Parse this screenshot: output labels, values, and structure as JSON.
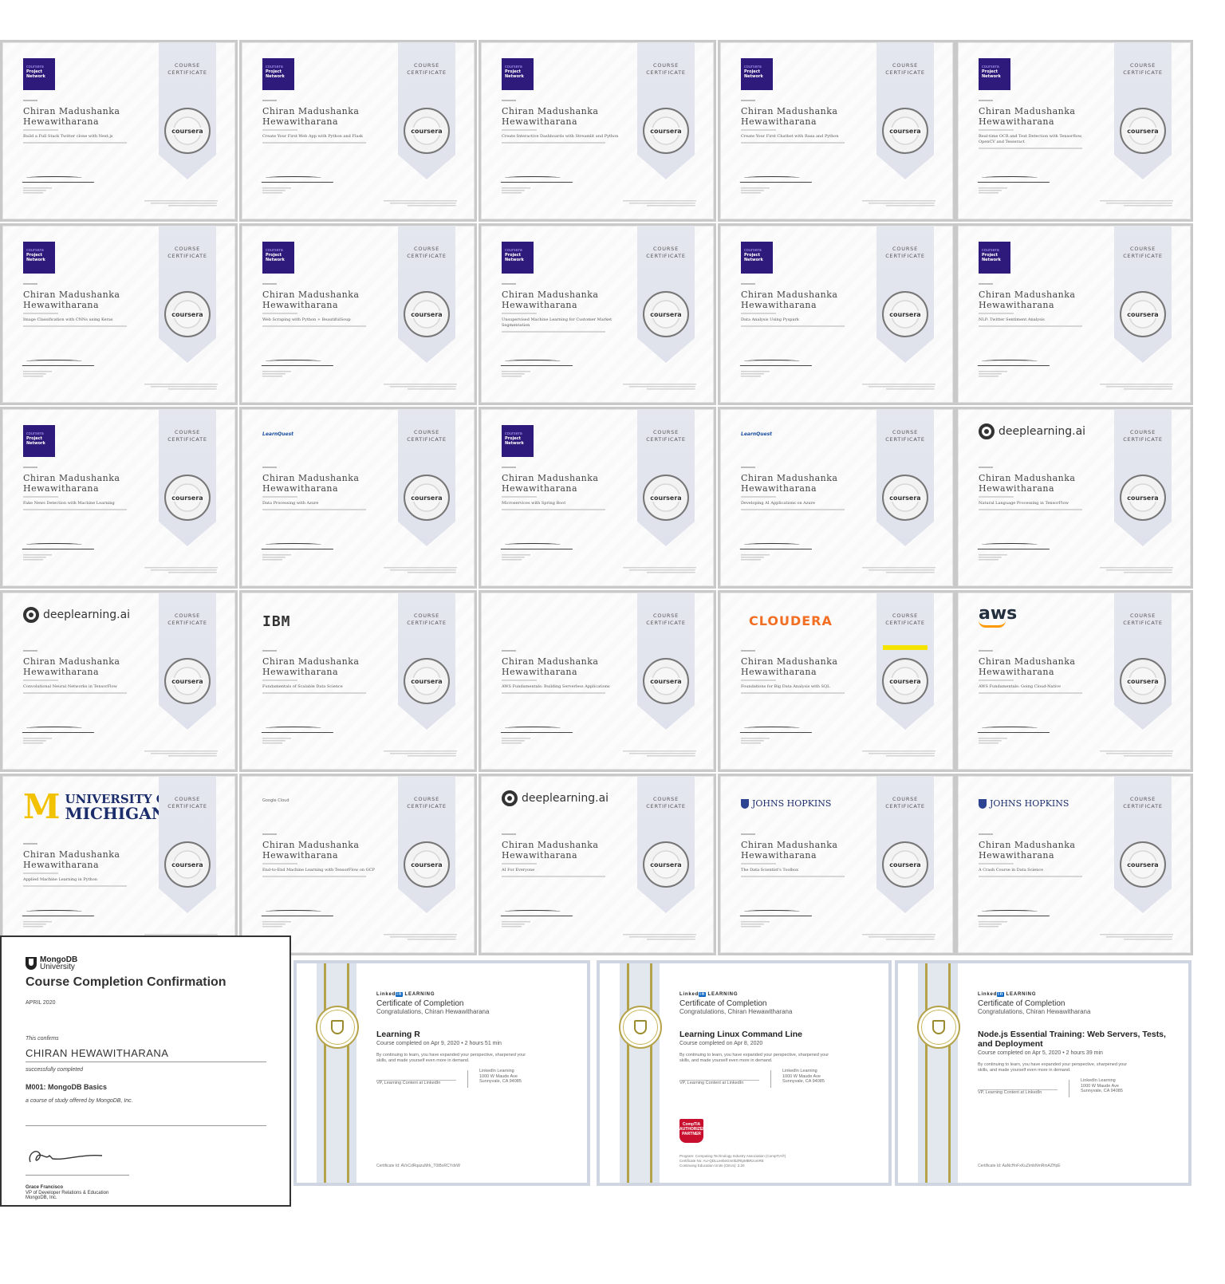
{
  "ribbon_text": "COURSE\nCERTIFICATE",
  "seal_text": "coursera",
  "learner_name": "Chiran Madushanka\nHewawitharana",
  "certificates": [
    {
      "logo": "coursera-project-network",
      "course": "Build a Full Stack Twitter clone with Next.js"
    },
    {
      "logo": "coursera-project-network",
      "course": "Create Your First Web App with Python and Flask"
    },
    {
      "logo": "coursera-project-network",
      "course": "Create Interactive Dashboards with Streamlit and Python"
    },
    {
      "logo": "coursera-project-network",
      "course": "Create Your First Chatbot with Rasa and Python"
    },
    {
      "logo": "coursera-project-network",
      "course": "Real-time OCR and Text Detection with Tensorflow, OpenCV and Tesseract"
    },
    {
      "logo": "coursera-project-network",
      "course": "Image Classification with CNNs using Keras"
    },
    {
      "logo": "coursera-project-network",
      "course": "Web Scraping with Python + BeautifulSoup"
    },
    {
      "logo": "coursera-project-network",
      "course": "Unsupervised Machine Learning for Customer Market Segmentation"
    },
    {
      "logo": "coursera-project-network",
      "course": "Data Analysis Using Pyspark"
    },
    {
      "logo": "coursera-project-network",
      "course": "NLP: Twitter Sentiment Analysis"
    },
    {
      "logo": "coursera-project-network",
      "course": "Fake News Detection with Machine Learning"
    },
    {
      "logo": "learnquest",
      "course": "Data Processing with Azure"
    },
    {
      "logo": "coursera-project-network",
      "course": "Microservices with Spring Boot"
    },
    {
      "logo": "learnquest",
      "course": "Developing AI Applications on Azure"
    },
    {
      "logo": "deeplearning",
      "course": "Natural Language Processing in TensorFlow"
    },
    {
      "logo": "deeplearning",
      "course": "Convolutional Neural Networks in TensorFlow"
    },
    {
      "logo": "ibm",
      "course": "Fundamentals of Scalable Data Science"
    },
    {
      "logo": "none",
      "course": "AWS Fundamentals: Building Serverless Applications"
    },
    {
      "logo": "cloudera",
      "course": "Foundations for Big Data Analysis with SQL"
    },
    {
      "logo": "aws",
      "course": "AWS Fundamentals: Going Cloud-Native"
    },
    {
      "logo": "umich",
      "course": "Applied Machine Learning in Python"
    },
    {
      "logo": "google-cloud",
      "course": "End-to-End Machine Learning with TensorFlow on GCP"
    },
    {
      "logo": "deeplearning",
      "course": "AI For Everyone"
    },
    {
      "logo": "jhu",
      "course": "The Data Scientist's Toolbox"
    },
    {
      "logo": "jhu",
      "course": "A Crash Course in Data Science"
    }
  ],
  "logos": {
    "cpn_line1": "coursera",
    "cpn_line2": "Project",
    "cpn_line3": "Network",
    "deeplearning": "deeplearning.ai",
    "ibm": "IBM",
    "cloudera": "CLOUDERA",
    "aws": "aws",
    "learnquest": "LearnQuest",
    "umich_line1": "UNIVERSITY OF",
    "umich_line2": "MICHIGAN",
    "umich_block": "M",
    "google_cloud": "Google Cloud",
    "jhu": "JOHNS HOPKINS"
  },
  "mongodb": {
    "brand_line1": "MongoDB",
    "brand_line2": "University",
    "title": "Course Completion Confirmation",
    "date": "APRIL 2020",
    "confirms": "This confirms",
    "name": "CHIRAN HEWAWITHARANA",
    "completed": "successfully completed",
    "course": "M001: MongoDB Basics",
    "offered": "a course of study offered by MongoDB, Inc.",
    "signer_name": "Grace Francisco",
    "signer_title": "VP of Developer Relations & Education",
    "signer_org": "MongoDB, Inc."
  },
  "linkedin": [
    {
      "brand": "LEARNING",
      "heading": "Certificate of Completion",
      "congrats": "Congratulations, Chiran Hewawitharana",
      "course": "Learning R",
      "completed": "Course completed on Apr 9, 2020  •  2 hours 51 min",
      "body": "By continuing to learn, you have expanded your perspective, sharpened your skills, and made yourself even more in demand.",
      "signer_title": "VP, Learning Content at LinkedIn",
      "address": "LinkedIn Learning\n1000 W Maude Ave\nSunnyvale, CA 94085",
      "cert_no": "Certificate Id: AVxCdRqazuMrk_T0tBxRCYdvW"
    },
    {
      "brand": "LEARNING",
      "heading": "Certificate of Completion",
      "congrats": "Congratulations, Chiran Hewawitharana",
      "course": "Learning Linux Command Line",
      "completed": "Course completed on Apr 8, 2020",
      "body": "By continuing to learn, you have expanded your perspective, sharpened your skills, and made yourself even more in demand.",
      "signer_title": "VP, Learning Content at LinkedIn",
      "address": "LinkedIn Learning\n1000 W Maude Ave\nSunnyvale, CA 94085",
      "comptia": "CompTIA AUTHORIZED PARTNER",
      "program": "Program: Computing Technology Industry Association (CompTIA®)\nCertificate No: AU-QDLLeebeGm0bZRtpMBRzomRE\nContinuing Education Units (CEUs): 2.20"
    },
    {
      "brand": "LEARNING",
      "heading": "Certificate of Completion",
      "congrats": "Congratulations, Chiran Hewawitharana",
      "course": "Node.js Essential Training: Web Servers, Tests, and Deployment",
      "completed": "Course completed on Apr 5, 2020  •  2 hours 39 min",
      "body": "By continuing to learn, you have expanded your perspective, sharpened your skills, and made yourself even more in demand.",
      "signer_title": "VP, Learning Content at LinkedIn",
      "address": "LinkedIn Learning\n1000 W Maude Ave\nSunnyvale, CA 94085",
      "cert_no": "Certificate Id: AaNcHnFxKuZimbNmRmAZHpE"
    }
  ],
  "colors": {
    "ribbon": "#e2e5ee",
    "coursera_purple": "#2e1a7a",
    "cloudera_orange": "#f26e22",
    "aws_orange": "#ff9900",
    "umich_maize": "#f2c200",
    "linkedin_gold": "#b5a34a"
  }
}
